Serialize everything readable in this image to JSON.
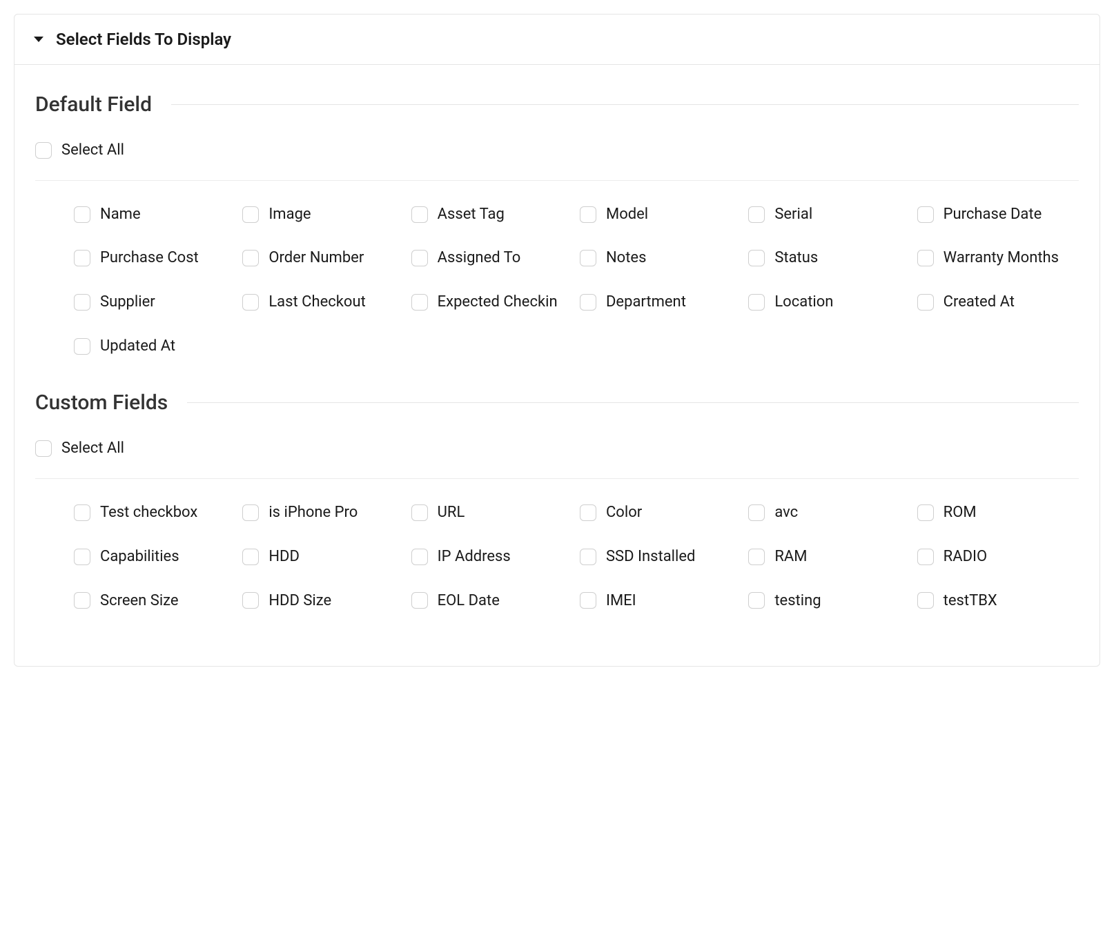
{
  "header": {
    "title": "Select Fields To Display"
  },
  "sections": [
    {
      "title": "Default Field",
      "select_all": "Select All",
      "fields": [
        "Name",
        "Image",
        "Asset Tag",
        "Model",
        "Serial",
        "Purchase Date",
        "Purchase Cost",
        "Order Number",
        "Assigned To",
        "Notes",
        "Status",
        "Warranty Months",
        "Supplier",
        "Last Checkout",
        "Expected Checkin",
        "Department",
        "Location",
        "Created At",
        "Updated At"
      ]
    },
    {
      "title": "Custom Fields",
      "select_all": "Select All",
      "fields": [
        "Test checkbox",
        "is iPhone Pro",
        "URL",
        "Color",
        "avc",
        "ROM",
        "Capabilities",
        "HDD",
        "IP Address",
        "SSD Installed",
        "RAM",
        "RADIO",
        "Screen Size",
        "HDD Size",
        "EOL Date",
        "IMEI",
        "testing",
        "testTBX"
      ]
    }
  ]
}
